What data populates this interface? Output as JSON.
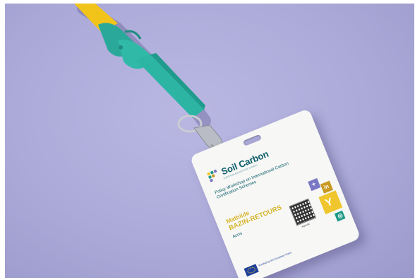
{
  "badge": {
    "brand": "Soil Carbon",
    "tagline": "EUROPEAN MISSION SOIL CARBON",
    "event": "Policy Workshop on International Carbon Certification Schemes",
    "first_name": "Mathilde",
    "last_name": "BAZIN-RETOURS",
    "organisation": "Accis",
    "qr_label": "Agenda",
    "eu_label": "Funded by the European Union"
  },
  "icons": {
    "social_1": "twitter-icon",
    "social_2": "linkedin-icon",
    "social_3": "soil-carbon-mark-icon",
    "social_4": "web-icon"
  },
  "colors": {
    "background": "#acaad8",
    "lanyard": "#2db5a4",
    "lanyard_end": "#f2c419",
    "badge_teal": "#0d5f6b",
    "badge_gold": "#d6b52c"
  }
}
